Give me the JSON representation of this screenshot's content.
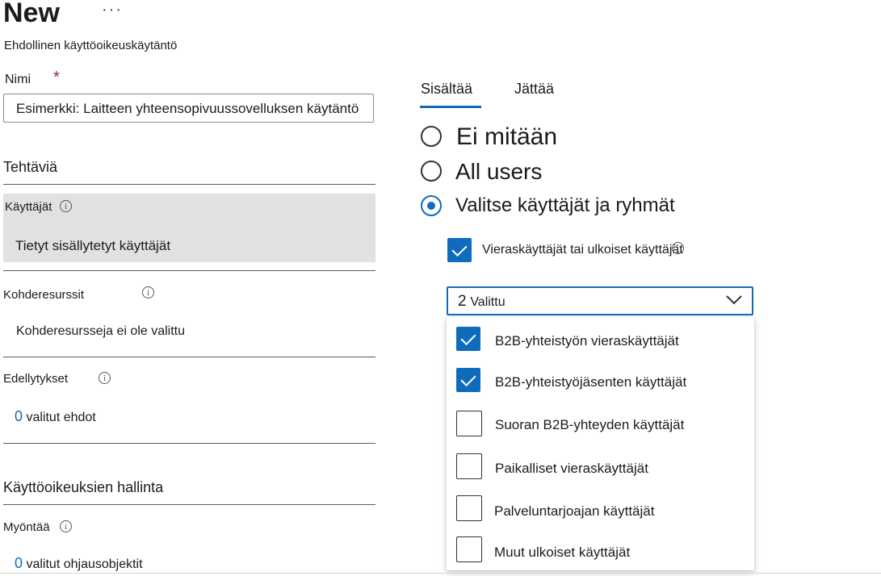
{
  "header": {
    "title": "New",
    "more_label": "···",
    "subtitle": "Ehdollinen käyttöoikeuskäytäntö"
  },
  "name_field": {
    "label": "Nimi",
    "required_marker": "*",
    "value": "Esimerkki: Laitteen yhteensopivuussovelluksen käytäntö"
  },
  "assignments": {
    "title": "Tehtäviä",
    "users": {
      "label": "Käyttäjät",
      "value": "Tietyt sisällytetyt käyttäjät"
    },
    "target_resources": {
      "label": "Kohderesurssit",
      "value": "Kohderesursseja ei ole valittu"
    },
    "conditions": {
      "label": "Edellytykset",
      "count": "0",
      "value": "valitut ehdot"
    }
  },
  "access_controls": {
    "title": "Käyttöoikeuksien hallinta",
    "grant": {
      "label": "Myöntää",
      "count": "0",
      "value": "valitut ohjausobjektit"
    }
  },
  "info_glyph": "i",
  "tabs": [
    {
      "label": "Sisältää",
      "active": true
    },
    {
      "label": "Jättää",
      "active": false
    }
  ],
  "radio_options": [
    {
      "label": "Ei mitään",
      "selected": false
    },
    {
      "label": "All users",
      "selected": false
    },
    {
      "label": "Valitse käyttäjät ja ryhmät",
      "selected": true
    }
  ],
  "guest_checkbox": {
    "label": "Vieraskäyttäjät tai ulkoiset käyttäjät",
    "checked": true
  },
  "guest_dropdown": {
    "count": "2",
    "value": "Valittu",
    "options": [
      {
        "label": "B2B-yhteistyön vieraskäyttäjät",
        "checked": true
      },
      {
        "label": "B2B-yhteistyöjäsenten käyttäjät",
        "checked": true
      },
      {
        "label": "Suoran B2B-yhteyden käyttäjät",
        "checked": false
      },
      {
        "label": "Paikalliset vieraskäyttäjät",
        "checked": false
      },
      {
        "label": "Palveluntarjoajan käyttäjät",
        "checked": false
      },
      {
        "label": "Muut ulkoiset käyttäjät",
        "checked": false
      }
    ]
  },
  "colors": {
    "accent": "#0f6cbd",
    "required": "#a4262c",
    "selected_row_bg": "#e1e1e1"
  }
}
